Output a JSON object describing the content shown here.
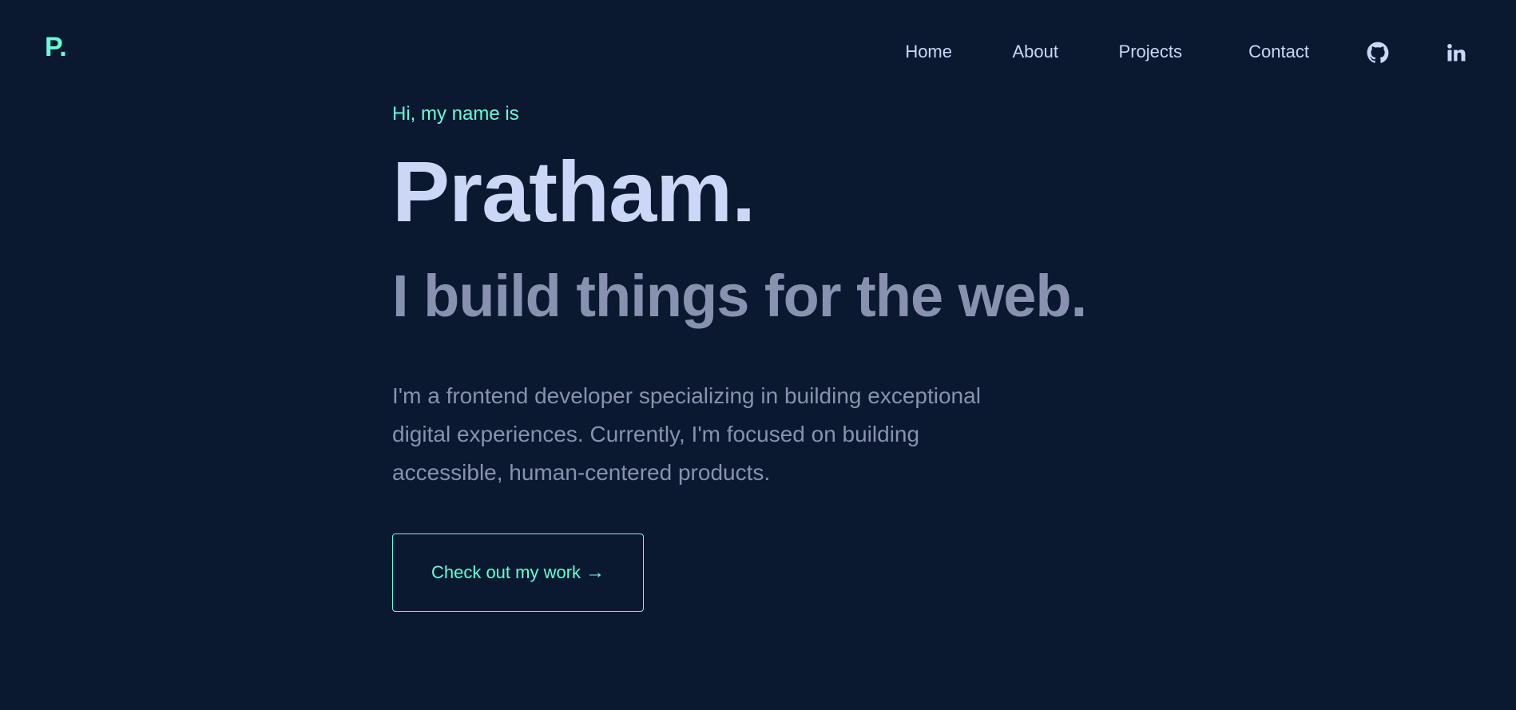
{
  "header": {
    "logo": "P.",
    "nav": [
      {
        "label": "Home"
      },
      {
        "label": "About"
      },
      {
        "label": "Projects"
      },
      {
        "label": "Contact"
      }
    ],
    "icons": [
      "github-icon",
      "linkedin-icon"
    ]
  },
  "hero": {
    "greeting": "Hi, my name is",
    "name": "Pratham.",
    "tagline": "I build things for the web.",
    "description": "I'm a frontend developer specializing in building exceptional digital experiences. Currently, I'm focused on building accessible, human-centered products.",
    "cta_label": "Check out my work",
    "cta_arrow": "→"
  },
  "colors": {
    "background": "#0a192f",
    "accent": "#64ffda",
    "heading": "#ccd6f6",
    "muted": "#8892b0"
  }
}
